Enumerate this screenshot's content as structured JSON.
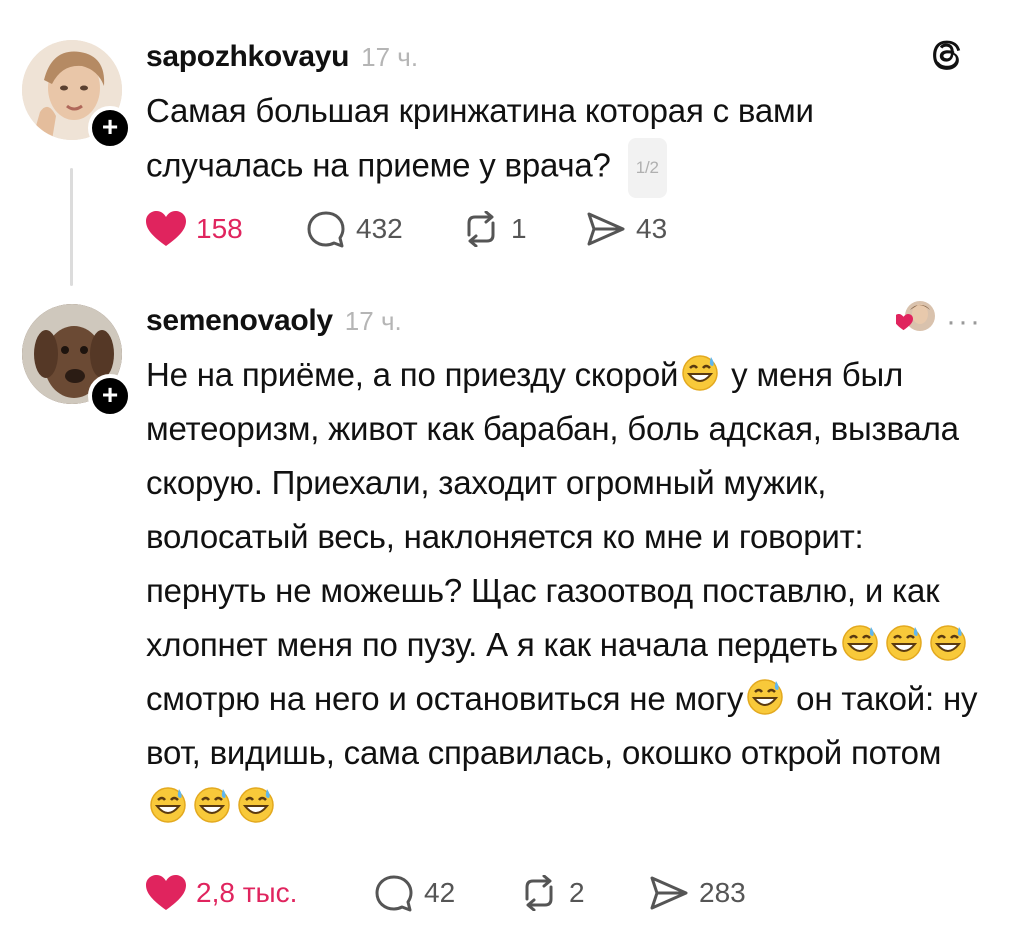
{
  "post": {
    "username": "sapozhkovayu",
    "time": "17 ч.",
    "text_line1": "Самая большая кринжатина которая с вами",
    "text_line2": "случалась на приеме у врача?",
    "page_indicator": "1/2",
    "likes": "158",
    "replies": "432",
    "reposts": "1",
    "shares": "43"
  },
  "reply": {
    "username": "semenovaoly",
    "time": "17 ч.",
    "segments": {
      "s1": "Не на приёме,  а по приезду скорой",
      "s2": " у меня был метеоризм, живот как барабан, боль адская, вызвала скорую.  Приехали,  заходит огромный мужик, волосатый весь, наклоняется ко мне и говорит: пернуть не можешь? Щас газоотвод поставлю, и как хлопнет меня по пузу. А я как начала пердеть",
      "s3": " смотрю на него и остановиться не могу",
      "s4": " он такой: ну вот, видишь, сама справилась, окошко открой потом"
    },
    "likes": "2,8 тыс.",
    "replies": "42",
    "reposts": "2",
    "shares": "283"
  },
  "colors": {
    "heart": "#e0245e",
    "thread_line": "#dcdcdc",
    "muted_text": "#b5b5b5"
  },
  "icons": [
    "threads-logo-icon",
    "heart-icon",
    "comment-icon",
    "repost-icon",
    "share-icon",
    "more-icon",
    "grinning-sweat-emoji"
  ]
}
